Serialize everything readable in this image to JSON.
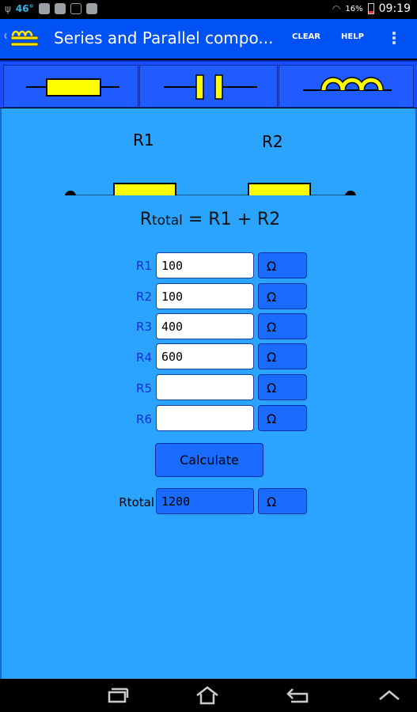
{
  "status_bar": {
    "temperature": "46°",
    "battery": "16%",
    "time": "09:19"
  },
  "action_bar": {
    "title": "Series and Parallel compo...",
    "clear_label": "CLEAR",
    "help_label": "HELP"
  },
  "tabs": [
    {
      "name": "resistor-tab",
      "icon": "resistor-icon"
    },
    {
      "name": "capacitor-tab",
      "icon": "capacitor-icon"
    },
    {
      "name": "inductor-tab",
      "icon": "inductor-icon"
    }
  ],
  "circuit": {
    "label_r1": "R1",
    "label_r2": "R2"
  },
  "formula": {
    "lhs_main": "R",
    "lhs_sub": "total",
    "rhs": " = R1 + R2"
  },
  "inputs": [
    {
      "label": "R1",
      "value": "100",
      "unit": "Ω"
    },
    {
      "label": "R2",
      "value": "100",
      "unit": "Ω"
    },
    {
      "label": "R3",
      "value": "400",
      "unit": "Ω"
    },
    {
      "label": "R4",
      "value": "600",
      "unit": "Ω"
    },
    {
      "label": "R5",
      "value": "",
      "unit": "Ω"
    },
    {
      "label": "R6",
      "value": "",
      "unit": "Ω"
    }
  ],
  "calculate_label": "Calculate",
  "result": {
    "label": "Rtotal",
    "value": "1200",
    "unit": "Ω"
  },
  "colors": {
    "action_bar": "#0052f5",
    "content_bg": "#2aa4ff",
    "component_fill": "#ffff00"
  }
}
